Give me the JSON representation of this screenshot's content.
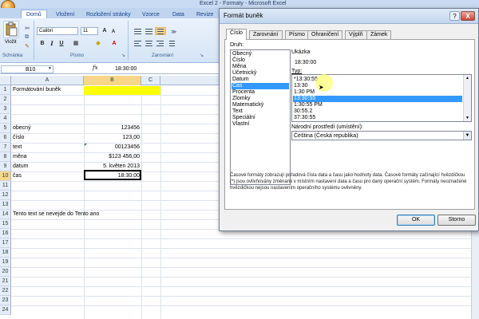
{
  "window": {
    "title": "Excel 2 - Formaty - Microsoft Excel"
  },
  "ribbon": {
    "tabs": [
      "Domů",
      "Vložení",
      "Rozložení stránky",
      "Vzorce",
      "Data",
      "Revize"
    ],
    "active_tab": "Domů",
    "clipboard": {
      "paste_label": "Vložit",
      "group": "Schránka"
    },
    "font": {
      "name": "Calibri",
      "size": "11",
      "group": "Písmo"
    },
    "alignment": {
      "group": "Zarovnání"
    }
  },
  "formula_bar": {
    "cell_ref": "B10",
    "fx": "fx",
    "value": "18:30:00"
  },
  "grid": {
    "columns": [
      "A",
      "B",
      "C"
    ],
    "rows": [
      "1",
      "2",
      "3",
      "4",
      "5",
      "6",
      "7",
      "8",
      "9",
      "10",
      "11",
      "12",
      "13",
      "14",
      "15",
      "16",
      "17",
      "18",
      "19",
      "20",
      "21",
      "22",
      "23",
      "24"
    ],
    "cells": {
      "a1": "Formátování buněk",
      "a5": "obecný",
      "b5": "123456",
      "a6": "číslo",
      "b6": "123,00",
      "a7": "text",
      "b7": "00123456",
      "a8": "měna",
      "b8": "$123 456,00",
      "a9": "datum",
      "b9": "5. květen 2013",
      "a10": "čas",
      "b10": "18:30:00",
      "a14": "Tento text se nevejde do Tento ano"
    }
  },
  "dialog": {
    "title": "Formát buněk",
    "help": "?",
    "close": "X",
    "tabs": [
      "Číslo",
      "Zarovnání",
      "Písmo",
      "Ohraničení",
      "Výplň",
      "Zámek"
    ],
    "active_tab": "Číslo",
    "category_label": "Druh:",
    "categories": [
      "Obecný",
      "Číslo",
      "Měna",
      "Účetnický",
      "Datum",
      "Čas",
      "Procenta",
      "Zlomky",
      "Matematický",
      "Text",
      "Speciální",
      "Vlastní"
    ],
    "selected_category": "Čas",
    "sample_label": "Ukázka",
    "sample_value": "18:30:00",
    "type_label": "Typ:",
    "types": [
      "*13:30:55",
      "13:30",
      "1:30 PM",
      "13:30:55",
      "1:30:55 PM",
      "30:55.2",
      "37:30:55"
    ],
    "selected_type": "13:30:55",
    "locale_label": "Národní prostředí (umístění):",
    "locale_value": "Čeština (Česká republika)",
    "description": "Časové formáty zobrazují pořadová čísla data a času jako hodnoty data. Časové formáty začínající hvězdičkou (*) jsou ovlivňovány změnami v místním nastavení data a času pro daný operační systém. Formáty neoznačené hvězdičkou nejsou nastavením operačního systému ovlivněny.",
    "ok_label": "OK",
    "cancel_label": "Storno"
  }
}
